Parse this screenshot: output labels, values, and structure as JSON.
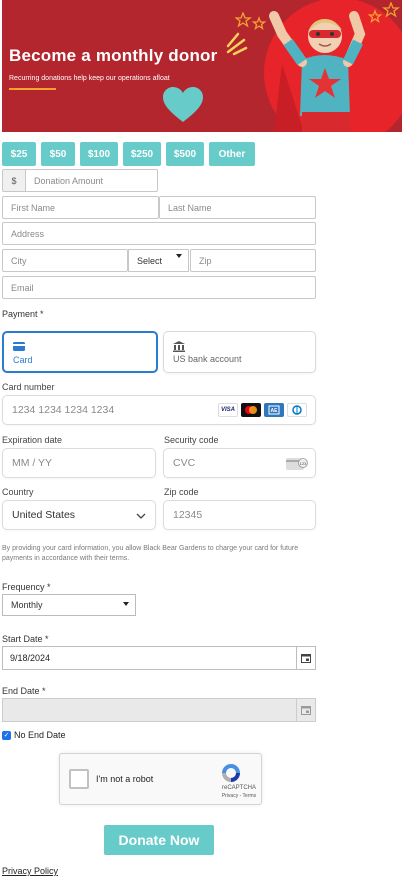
{
  "banner": {
    "title": "Become a monthly donor",
    "subtitle": "Recurring donations help keep our operations afloat",
    "colors": {
      "background": "#b3262e",
      "circle": "#e8242b",
      "accent": "#f3a233",
      "heart": "#66cbc9"
    }
  },
  "amounts": [
    "$25",
    "$50",
    "$100",
    "$250",
    "$500",
    "Other"
  ],
  "donation": {
    "currency_symbol": "$",
    "amount_placeholder": "Donation Amount"
  },
  "personal": {
    "first_name_placeholder": "First Name",
    "last_name_placeholder": "Last Name",
    "address_placeholder": "Address",
    "city_placeholder": "City",
    "state_value": "Select",
    "zip_placeholder": "Zip",
    "email_placeholder": "Email"
  },
  "payment": {
    "label": "Payment *",
    "tabs": [
      {
        "label": "Card",
        "icon": "card-icon",
        "active": true
      },
      {
        "label": "US bank account",
        "icon": "bank-icon",
        "active": false
      }
    ],
    "card_number_label": "Card number",
    "card_number_placeholder": "1234 1234 1234 1234",
    "brands": [
      "VISA",
      "mastercard-icon",
      "amex-icon",
      "diners-icon"
    ],
    "expiration_label": "Expiration date",
    "expiration_placeholder": "MM / YY",
    "security_label": "Security code",
    "security_placeholder": "CVC",
    "country_label": "Country",
    "country_value": "United States",
    "zip_label": "Zip code",
    "zip_placeholder": "12345",
    "disclaimer": "By providing your card information, you allow Black Bear Gardens to charge your card for future payments in accordance with their terms."
  },
  "frequency": {
    "label": "Frequency *",
    "value": "Monthly"
  },
  "start_date": {
    "label": "Start Date *",
    "value": "9/18/2024"
  },
  "end_date": {
    "label": "End Date *",
    "value": ""
  },
  "no_end_date": {
    "label": "No End Date",
    "checked": true
  },
  "recaptcha": {
    "text": "I'm not a robot",
    "brand": "reCAPTCHA",
    "links": "Privacy - Terms"
  },
  "donate_button": "Donate Now",
  "privacy_policy": "Privacy Policy"
}
